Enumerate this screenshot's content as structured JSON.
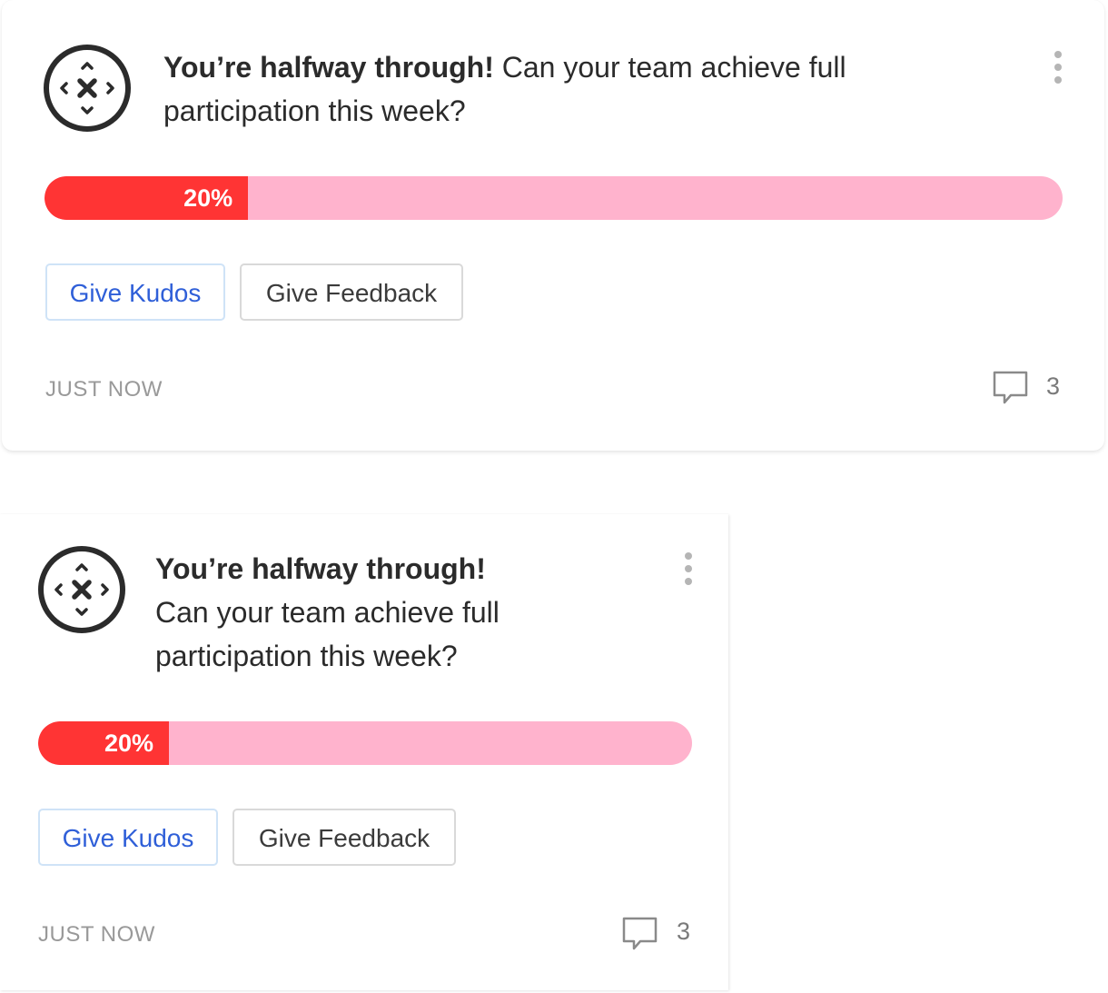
{
  "cards": [
    {
      "headline_bold": "You’re halfway through!",
      "headline_rest": "Can your team achieve full participation this week?",
      "progress": {
        "value_percent": 20,
        "label": "20%"
      },
      "kudos_label": "Give Kudos",
      "feedback_label": "Give Feedback",
      "timestamp": "JUST NOW",
      "comment_count": "3"
    },
    {
      "headline_bold": "You’re halfway through!",
      "headline_rest": "Can your team achieve full participation this week?",
      "progress": {
        "value_percent": 20,
        "label": "20%"
      },
      "kudos_label": "Give Kudos",
      "feedback_label": "Give Feedback",
      "timestamp": "JUST NOW",
      "comment_count": "3"
    }
  ],
  "colors": {
    "progress_fill": "#ff3434",
    "progress_track": "#ffb3cd",
    "kudos_text": "#2f5fd8",
    "kudos_border": "#cfe3f7",
    "timestamp_text": "#999999"
  },
  "icons": {
    "logo": "compass-arrows-logo-icon",
    "menu": "kebab-menu-icon",
    "comment": "speech-bubble-icon"
  }
}
